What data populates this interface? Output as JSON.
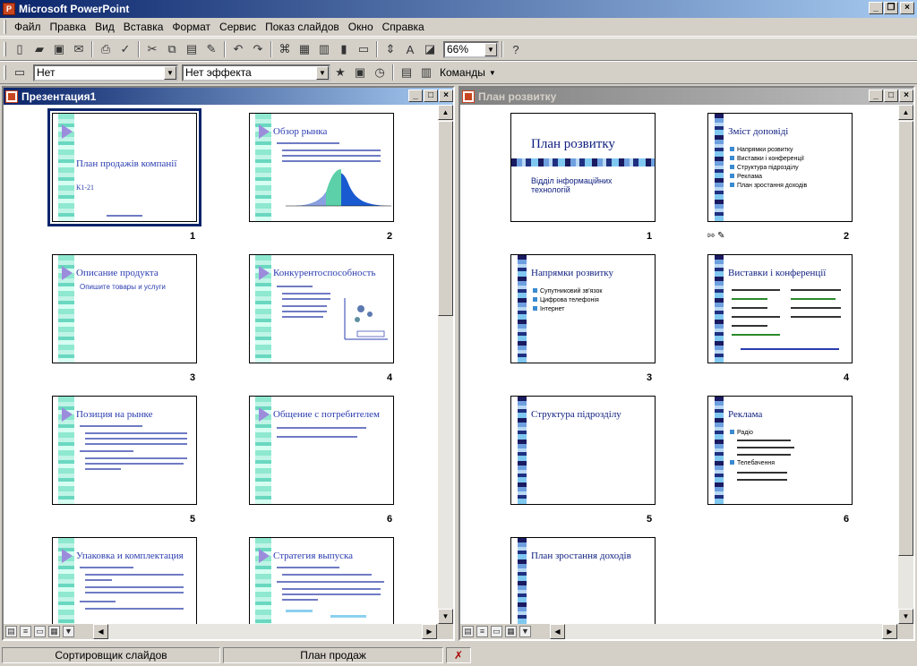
{
  "app": {
    "title": "Microsoft PowerPoint"
  },
  "menu": [
    "Файл",
    "Правка",
    "Вид",
    "Вставка",
    "Формат",
    "Сервис",
    "Показ слайдов",
    "Окно",
    "Справка"
  ],
  "toolbar": {
    "zoom": "66%"
  },
  "toolbar2": {
    "transition": "Нет",
    "effect": "Нет эффекта",
    "commands": "Команды"
  },
  "left_pane": {
    "title": "Презентация1",
    "slides": [
      {
        "num": "1",
        "title": "План продажів компанії",
        "sub": "К1-21"
      },
      {
        "num": "2",
        "title": "Обзор рынка"
      },
      {
        "num": "3",
        "title": "Описание продукта",
        "bullet": "Опишите товары и услуги"
      },
      {
        "num": "4",
        "title": "Конкурентоспособность"
      },
      {
        "num": "5",
        "title": "Позиция на рынке"
      },
      {
        "num": "6",
        "title": "Общение с потребителем"
      },
      {
        "num": "7",
        "title": "Упаковка и комплектация"
      },
      {
        "num": "8",
        "title": "Стратегия выпуска"
      }
    ]
  },
  "right_pane": {
    "title": "План розвитку",
    "slides": [
      {
        "num": "1",
        "title": "План розвитку",
        "sub": "Відділ інформаційних технологій"
      },
      {
        "num": "2",
        "title": "Зміст доповіді",
        "bullets": [
          "Напрямки розвитку",
          "Виставки і конференції",
          "Структура підрозділу",
          "Реклама",
          "План зростання доходів"
        ]
      },
      {
        "num": "3",
        "title": "Напрямки розвитку",
        "bullets": [
          "Супутниковий зв'язок",
          "Цифрова телефонія",
          "Інтернет"
        ]
      },
      {
        "num": "4",
        "title": "Виставки і конференції"
      },
      {
        "num": "5",
        "title": "Структура підрозділу"
      },
      {
        "num": "6",
        "title": "Реклама",
        "bullets": [
          "Радіо",
          "Телебачення"
        ]
      },
      {
        "num": "7",
        "title": "План зростання доходів"
      }
    ]
  },
  "status": {
    "view": "Сортировщик слайдов",
    "design": "План продаж"
  }
}
